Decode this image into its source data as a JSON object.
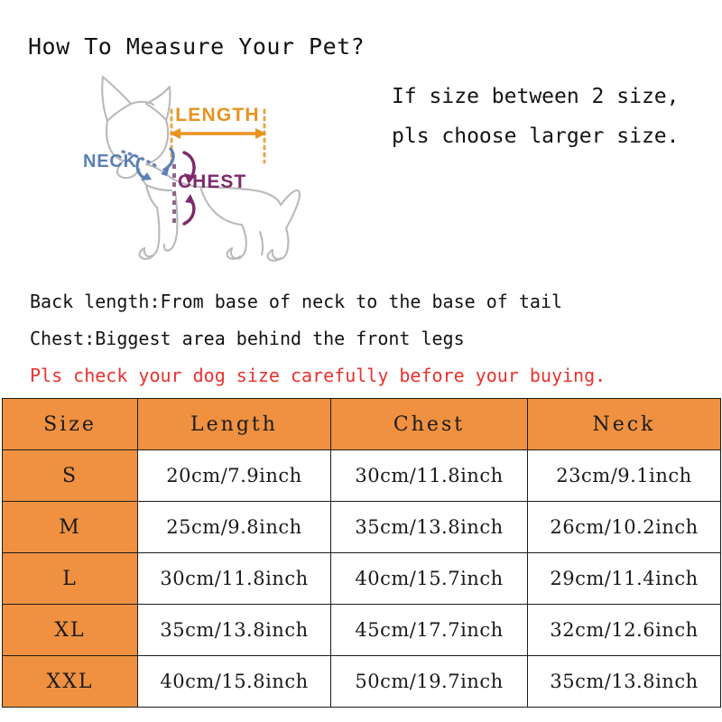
{
  "page": {
    "title": "How To Measure Your Pet?"
  },
  "diagram": {
    "name": "pet-measurement-diagram",
    "outline_color": "#b9b9bd",
    "labels": {
      "length": "LENGTH",
      "neck": "NECK",
      "chest": "CHEST"
    },
    "label_colors": {
      "length": "#e8921f",
      "neck": "#5b7fb5",
      "chest": "#7d2a6e"
    }
  },
  "size_note": {
    "lines": [
      "If size between 2 size,",
      "pls choose larger size."
    ]
  },
  "descriptions": {
    "lines": [
      "Back length:From base of neck to the base of tail",
      "Chest:Biggest area behind the front legs"
    ],
    "warning": "Pls check your dog size carefully before your buying.",
    "warning_color": "#e8322d"
  },
  "table": {
    "accent_color": "#ef9140",
    "headers": [
      "Size",
      "Length",
      "Chest",
      "Neck"
    ],
    "rows": [
      {
        "size": "S",
        "length": "20cm/7.9inch",
        "chest": "30cm/11.8inch",
        "neck": "23cm/9.1inch"
      },
      {
        "size": "M",
        "length": "25cm/9.8inch",
        "chest": "35cm/13.8inch",
        "neck": "26cm/10.2inch"
      },
      {
        "size": "L",
        "length": "30cm/11.8inch",
        "chest": "40cm/15.7inch",
        "neck": "29cm/11.4inch"
      },
      {
        "size": "XL",
        "length": "35cm/13.8inch",
        "chest": "45cm/17.7inch",
        "neck": "32cm/12.6inch"
      },
      {
        "size": "XXL",
        "length": "40cm/15.8inch",
        "chest": "50cm/19.7inch",
        "neck": "35cm/13.8inch"
      }
    ]
  }
}
